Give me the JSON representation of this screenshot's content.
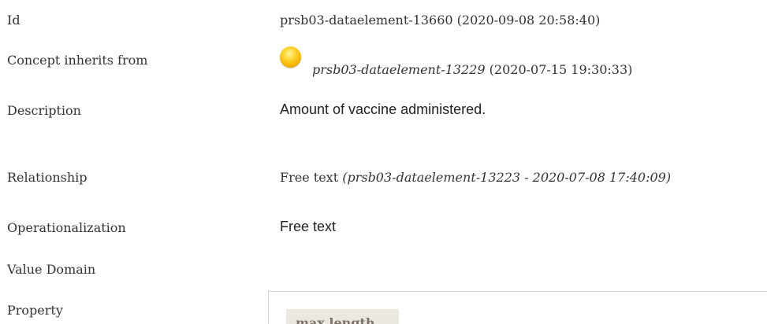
{
  "rows": {
    "id": {
      "label": "Id",
      "value": "prsb03-dataelement-13660 (2020-09-08 20:58:40)"
    },
    "inherits": {
      "label": "Concept inherits from",
      "status_icon": "yellow-status-ball-icon",
      "link": "prsb03-dataelement-13229",
      "date": " (2020-07-15 19:30:33)"
    },
    "description": {
      "label": "Description",
      "value": "Amount of vaccine administered."
    },
    "relationship": {
      "label": "Relationship",
      "value": "Free text ",
      "ref": "(prsb03-dataelement-13223 - 2020-07-08 17:40:09)"
    },
    "operationalization": {
      "label": "Operationalization",
      "value": "Free text"
    },
    "value_domain": {
      "label": "Value Domain"
    },
    "property": {
      "label": "Property",
      "tag": "max length"
    }
  },
  "colors": {
    "text": "#333333",
    "panel_border": "#d7d3c8",
    "tag_background": "#ece8df",
    "tag_text": "#7a746a",
    "status_ball": "#f5b400"
  }
}
